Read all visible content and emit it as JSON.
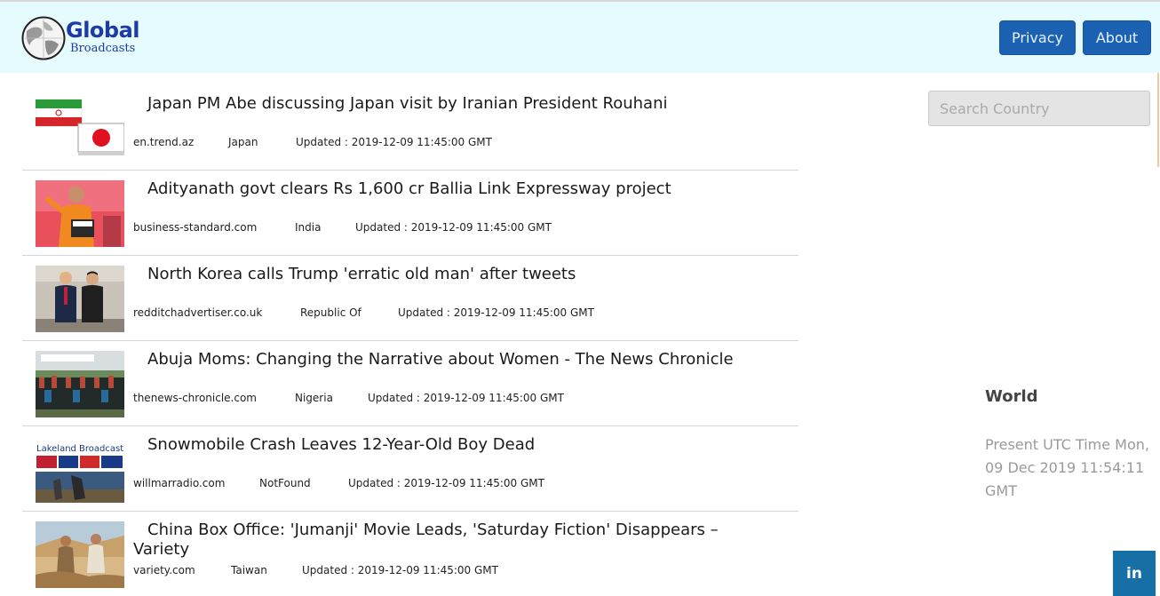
{
  "brand": {
    "title": "Global",
    "subtitle": "Broadcasts"
  },
  "nav": {
    "privacy_label": "Privacy",
    "about_label": "About"
  },
  "search": {
    "placeholder": "Search Country"
  },
  "news": [
    {
      "headline": "Japan PM Abe discussing Japan visit by Iranian President Rouhani",
      "source": "en.trend.az",
      "country": "Japan",
      "updated": "Updated : 2019-12-09 11:45:00 GMT"
    },
    {
      "headline": "Adityanath govt clears Rs 1,600 cr Ballia Link Expressway project",
      "source": "business-standard.com",
      "country": "India",
      "updated": "Updated : 2019-12-09 11:45:00 GMT"
    },
    {
      "headline": "North Korea calls Trump 'erratic old man' after tweets",
      "source": "redditchadvertiser.co.uk",
      "country": "Republic Of",
      "updated": "Updated : 2019-12-09 11:45:00 GMT"
    },
    {
      "headline": "Abuja Moms: Changing the Narrative about Women - The News Chronicle",
      "source": "thenews-chronicle.com",
      "country": "Nigeria",
      "updated": "Updated : 2019-12-09 11:45:00 GMT"
    },
    {
      "headline": "Snowmobile Crash Leaves 12-Year-Old Boy Dead",
      "source": "willmarradio.com",
      "country": "NotFound",
      "updated": "Updated : 2019-12-09 11:45:00 GMT"
    },
    {
      "headline": "China Box Office: 'Jumanji' Movie Leads, 'Saturday Fiction' Disappears – Variety",
      "source": "variety.com",
      "country": "Taiwan",
      "updated": "Updated : 2019-12-09 11:45:00 GMT"
    }
  ],
  "sidebar": {
    "world_title": "World",
    "utc_text": "Present UTC Time Mon, 09 Dec 2019 11:54:11 GMT"
  },
  "thumb_text": {
    "radio_station": "Lakeland Broadcasting"
  },
  "social": {
    "linkedin_label": "in"
  },
  "colors": {
    "navbar_bg": "#e6fbfd",
    "button": "#1b62b3",
    "brand": "#1d3aa6",
    "linkedin": "#1670a6"
  }
}
